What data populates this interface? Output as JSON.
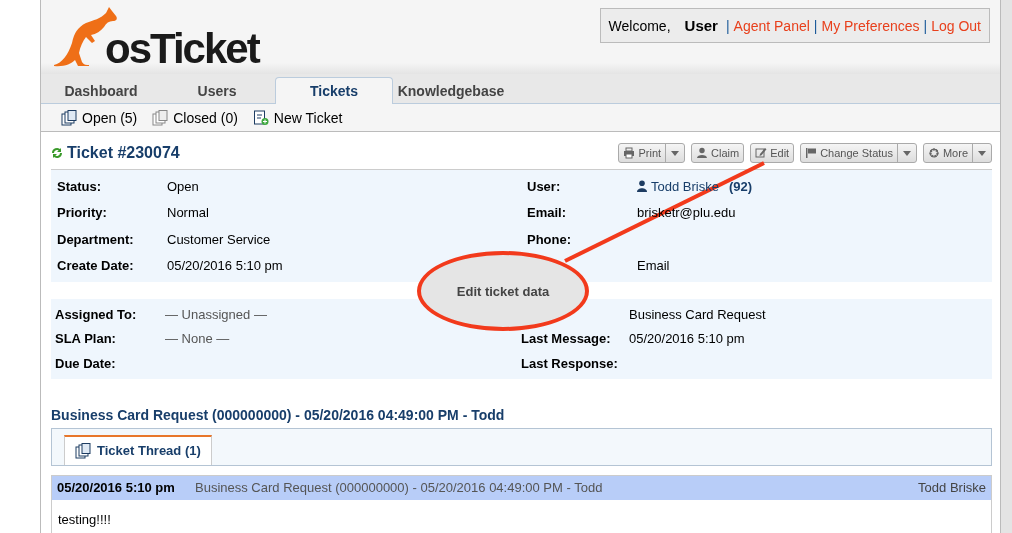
{
  "header": {
    "logo_text": "osTicket",
    "welcome": "Welcome,",
    "user": "User",
    "separator": "|",
    "links": [
      "Agent Panel",
      "My Preferences",
      "Log Out"
    ]
  },
  "tabs": [
    {
      "label": "Dashboard",
      "selected": false
    },
    {
      "label": "Users",
      "selected": false
    },
    {
      "label": "Tickets",
      "selected": true
    },
    {
      "label": "Knowledgebase",
      "selected": false
    }
  ],
  "subnav": [
    {
      "label": "Open (5)",
      "kind": "open"
    },
    {
      "label": "Closed (0)",
      "kind": "closed"
    },
    {
      "label": "New Ticket",
      "kind": "new"
    }
  ],
  "ticket": {
    "title": "Ticket #230074",
    "actions": [
      {
        "label": "Print",
        "kind": "print",
        "dropdown": true
      },
      {
        "label": "Claim",
        "kind": "claim",
        "dropdown": false
      },
      {
        "label": "Edit",
        "kind": "edit",
        "dropdown": false
      },
      {
        "label": "Change Status",
        "kind": "status",
        "dropdown": true
      },
      {
        "label": "More",
        "kind": "more",
        "dropdown": true
      }
    ],
    "sections": [
      {
        "rows": [
          {
            "left": {
              "label": "Status:",
              "value": "Open"
            },
            "right": {
              "label": "User:",
              "value": "Todd Briske",
              "count": "(92)",
              "kind": "user"
            }
          },
          {
            "left": {
              "label": "Priority:",
              "value": "Normal"
            },
            "right": {
              "label": "Email:",
              "value": "brisketr@plu.edu"
            }
          },
          {
            "left": {
              "label": "Department:",
              "value": "Customer Service"
            },
            "right": {
              "label": "Phone:"
            }
          },
          {
            "left": {
              "label": "Create Date:",
              "value": "05/20/2016 5:10 pm"
            },
            "right": {
              "value": "Email"
            }
          }
        ]
      },
      {
        "rows": [
          {
            "left": {
              "label": "Assigned To:",
              "value": "— Unassigned —",
              "kind": "muted"
            },
            "right": {
              "value": "Business Card Request"
            }
          },
          {
            "left": {
              "label": "SLA Plan:",
              "value": "— None —",
              "kind": "muted"
            },
            "right": {
              "label": "Last Message:",
              "value": "05/20/2016 5:10 pm"
            }
          },
          {
            "left": {
              "label": "Due Date:"
            },
            "right": {
              "label": "Last Response:"
            }
          }
        ]
      }
    ]
  },
  "thread": {
    "heading": "Business Card Request (000000000) - 05/20/2016 04:49:00 PM - Todd",
    "tabs": [
      {
        "label": "Ticket Thread (1)",
        "selected": true
      }
    ],
    "entries": [
      {
        "date": "05/20/2016 5:10 pm",
        "subject": "Business Card Request (000000000) - 05/20/2016 04:49:00 PM - Todd",
        "author": "Todd Briske",
        "body": "testing!!!!"
      }
    ]
  },
  "annotation": {
    "text": "Edit ticket data"
  }
}
